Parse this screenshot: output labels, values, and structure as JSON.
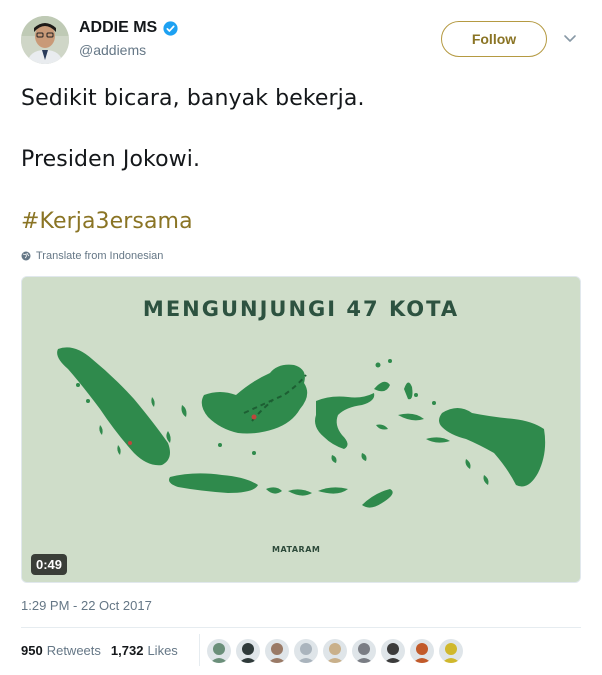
{
  "author": {
    "name": "ADDIE MS",
    "handle": "@addiems",
    "verified": true
  },
  "follow_label": "Follow",
  "tweet": {
    "line1": "Sedikit bicara, banyak bekerja.",
    "line2": "Presiden Jokowi.",
    "hashtag": "#Kerja3ersama"
  },
  "translate_label": "Translate from Indonesian",
  "media": {
    "title": "MENGUNJUNGI 47 KOTA",
    "city_label": "MATARAM",
    "duration": "0:49"
  },
  "timestamp": "1:29 PM - 22 Oct 2017",
  "stats": {
    "retweets_count": "950",
    "retweets_label": "Retweets",
    "likes_count": "1,732",
    "likes_label": "Likes"
  },
  "colors": {
    "accent": "#8a7424",
    "map_bg": "#cfddc9",
    "land": "#2f8a4c"
  },
  "likers": [
    {
      "color": "#6b8f7a"
    },
    {
      "color": "#2f3a3a"
    },
    {
      "color": "#9a7a66"
    },
    {
      "color": "#aab4bd"
    },
    {
      "color": "#c9b08a"
    },
    {
      "color": "#7a7d84"
    },
    {
      "color": "#3b3b3b"
    },
    {
      "color": "#c25a2a"
    },
    {
      "color": "#d0b82c"
    }
  ]
}
